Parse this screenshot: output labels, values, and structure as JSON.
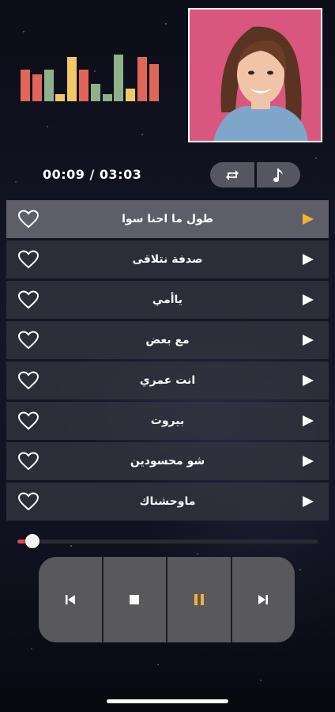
{
  "player": {
    "time_display": "00:09 / 03:03",
    "progress_fraction": 0.05
  },
  "equalizer": {
    "levels": [
      0.65,
      0.55,
      0.65,
      0.15,
      0.9,
      0.65,
      0.35,
      0.15,
      0.95,
      0.25,
      0.9,
      0.75
    ],
    "colors": [
      "#e0665a",
      "#e0665a",
      "#8fb08a",
      "#f2c766",
      "#f2c766",
      "#e0665a",
      "#8fb08a",
      "#8fb08a",
      "#8fb08a",
      "#f2c766",
      "#e0665a",
      "#e0665a"
    ]
  },
  "songs": [
    {
      "title": "طول ما احنا سوا",
      "active": true
    },
    {
      "title": "صدفة نتلاقى",
      "active": false
    },
    {
      "title": "ياأمي",
      "active": false
    },
    {
      "title": "مع بعض",
      "active": false
    },
    {
      "title": "انت عمري",
      "active": false
    },
    {
      "title": "بيروت",
      "active": false
    },
    {
      "title": "شو محسودين",
      "active": false
    },
    {
      "title": "ماوحشناك",
      "active": false
    }
  ],
  "colors": {
    "accent": "#f0b23a",
    "progress": "#e04848",
    "artist_bg": "#d9567e"
  },
  "icons": {
    "repeat": "repeat-icon",
    "music": "music-note-icon",
    "heart": "heart-icon",
    "play": "play-icon",
    "previous": "skip-previous-icon",
    "stop": "stop-icon",
    "pause": "pause-icon",
    "next": "skip-next-icon"
  }
}
